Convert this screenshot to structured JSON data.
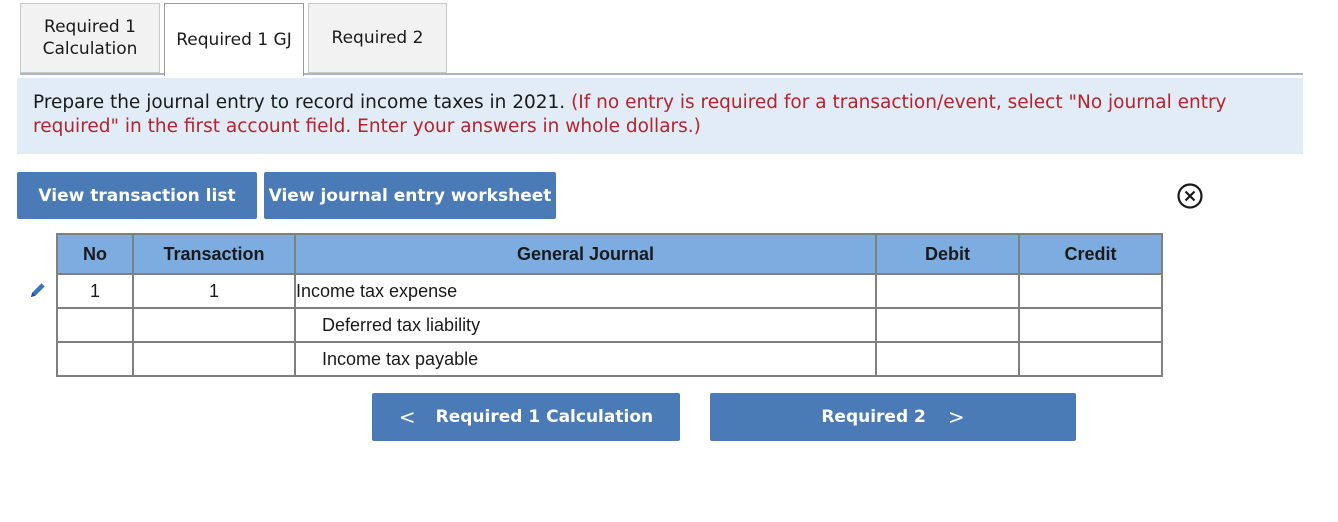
{
  "tabs": [
    {
      "label": "Required 1 Calculation",
      "line1": "Required 1",
      "line2": "Calculation",
      "active": false
    },
    {
      "label": "Required 1 GJ",
      "active": true
    },
    {
      "label": "Required 2",
      "active": false
    }
  ],
  "instructions": {
    "main": "Prepare the journal entry to record income taxes in 2021.",
    "note": "(If no entry is required for a transaction/event, select \"No journal entry required\" in the first account field. Enter your answers in whole dollars.)",
    "line1_main": "Prepare the journal entry to record income taxes in 2021.",
    "line1_note": "(If no entry is required for a transaction/event, select \"No journal entry",
    "line2_note": "required\" in the first account field. Enter your answers in whole dollars.)"
  },
  "buttons": {
    "view_transaction_list": "View transaction list",
    "view_journal_entry_worksheet": "View journal entry worksheet"
  },
  "close_icon": "close-circle-icon",
  "edit_icon": "pencil-icon",
  "table": {
    "headers": {
      "no": "No",
      "transaction": "Transaction",
      "general_journal": "General Journal",
      "debit": "Debit",
      "credit": "Credit"
    },
    "rows": [
      {
        "no": "1",
        "transaction": "1",
        "account": "Income tax expense",
        "debit": "",
        "credit": ""
      },
      {
        "no": "",
        "transaction": "",
        "account": "Deferred tax liability",
        "debit": "",
        "credit": ""
      },
      {
        "no": "",
        "transaction": "",
        "account": "Income tax payable",
        "debit": "",
        "credit": ""
      }
    ]
  },
  "nav": {
    "prev_label": "Required 1 Calculation",
    "next_label": "Required 2",
    "prev_icon": "chevron-left-icon",
    "next_icon": "chevron-right-icon"
  },
  "colors": {
    "button_blue": "#4a7bb7",
    "header_blue": "#7dace0",
    "instruction_bg": "#e1ecf7",
    "note_red": "#b5232b"
  }
}
